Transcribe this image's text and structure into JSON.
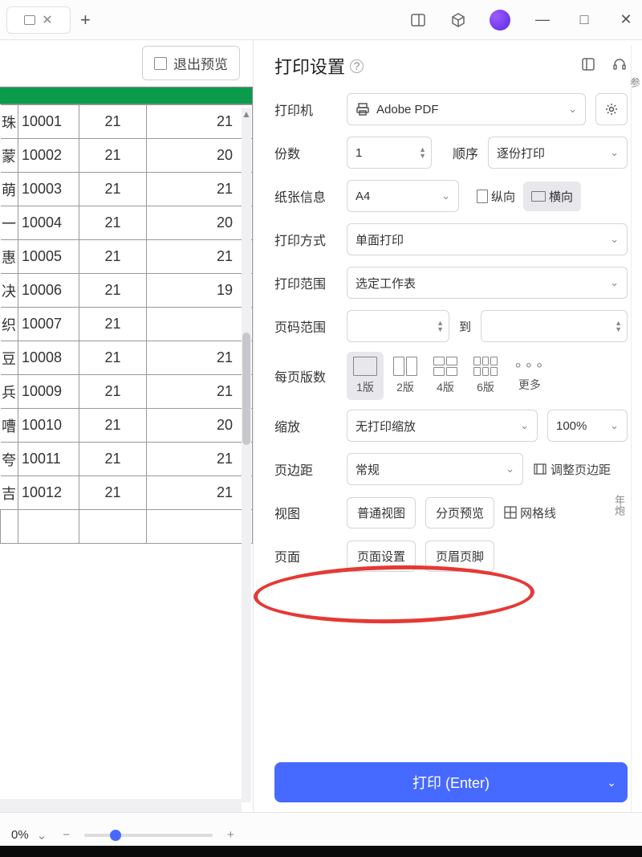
{
  "titlebar": {
    "newtab": "+",
    "minimize": "—",
    "maximize": "□",
    "close": "✕"
  },
  "toolbar": {
    "exit_preview": "退出预览"
  },
  "table": {
    "rows": [
      {
        "n": "珠",
        "id": "10001",
        "a": "21",
        "b": "21"
      },
      {
        "n": "蒙",
        "id": "10002",
        "a": "21",
        "b": "20"
      },
      {
        "n": "萌",
        "id": "10003",
        "a": "21",
        "b": "21"
      },
      {
        "n": "一",
        "id": "10004",
        "a": "21",
        "b": "20"
      },
      {
        "n": "惠",
        "id": "10005",
        "a": "21",
        "b": "21"
      },
      {
        "n": "决",
        "id": "10006",
        "a": "21",
        "b": "19"
      },
      {
        "n": "织",
        "id": "10007",
        "a": "21",
        "b": ""
      },
      {
        "n": "豆",
        "id": "10008",
        "a": "21",
        "b": "21"
      },
      {
        "n": "兵",
        "id": "10009",
        "a": "21",
        "b": "21"
      },
      {
        "n": "嘈",
        "id": "10010",
        "a": "21",
        "b": "20"
      },
      {
        "n": "夸",
        "id": "10011",
        "a": "21",
        "b": "21"
      },
      {
        "n": "吉",
        "id": "10012",
        "a": "21",
        "b": "21"
      }
    ]
  },
  "panel": {
    "title": "打印设置",
    "printer_lbl": "打印机",
    "printer_val": "Adobe PDF",
    "copies_lbl": "份数",
    "copies_val": "1",
    "order_lbl": "顺序",
    "order_val": "逐份打印",
    "paper_lbl": "纸张信息",
    "paper_val": "A4",
    "orient_portrait": "纵向",
    "orient_landscape": "横向",
    "mode_lbl": "打印方式",
    "mode_val": "单面打印",
    "range_lbl": "打印范围",
    "range_val": "选定工作表",
    "pages_lbl": "页码范围",
    "pages_to": "到",
    "layout_lbl": "每页版数",
    "layout_opts": [
      "1版",
      "2版",
      "4版",
      "6版",
      "更多"
    ],
    "zoom_lbl": "缩放",
    "zoom_val": "无打印缩放",
    "zoom_pct": "100%",
    "margin_lbl": "页边距",
    "margin_val": "常规",
    "margin_adjust": "调整页边距",
    "view_lbl": "视图",
    "view_normal": "普通视图",
    "view_page": "分页预览",
    "view_grid": "网格线",
    "page_lbl": "页面",
    "page_setup": "页面设置",
    "page_hf": "页眉页脚",
    "print_btn": "打印 (Enter)"
  },
  "status": {
    "zoom": "0%",
    "minus": "−",
    "plus": "+"
  },
  "side": {
    "t1": "参",
    "t2": "年炮"
  }
}
